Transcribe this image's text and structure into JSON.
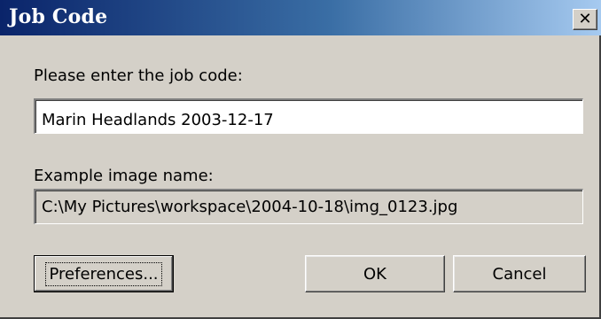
{
  "window": {
    "title": "Job Code",
    "close_glyph": "✕"
  },
  "form": {
    "prompt_label": "Please enter the job code:",
    "job_code_value": "Marin Headlands 2003-12-17",
    "example_label": "Example image name:",
    "example_value": "C:\\My Pictures\\workspace\\2004-10-18\\img_0123.jpg"
  },
  "buttons": {
    "preferences": "Preferences...",
    "ok": "OK",
    "cancel": "Cancel"
  },
  "icons": {
    "close": "close-icon"
  },
  "colors": {
    "titlebar_start": "#0a246a",
    "titlebar_end": "#a6caf0",
    "dialog_bg": "#d4d0c8"
  }
}
